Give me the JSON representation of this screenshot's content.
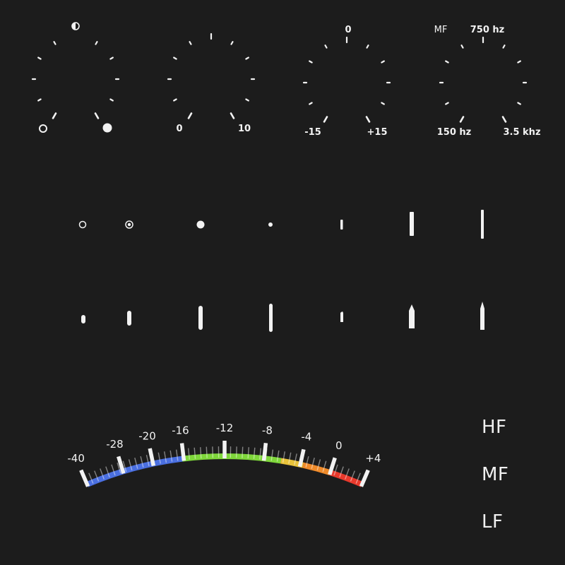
{
  "knobs": [
    {
      "id": "knob-pan",
      "top_label": "",
      "left_label": "",
      "right_label": "",
      "min_icon": "ring",
      "max_icon": "dot",
      "top_icon": "half-circle"
    },
    {
      "id": "knob-level",
      "top_label": "",
      "left_label": "0",
      "right_label": "10"
    },
    {
      "id": "knob-gain",
      "top_label": "0",
      "left_label": "-15",
      "right_label": "+15"
    },
    {
      "id": "knob-mf-freq",
      "corner_label": "MF",
      "top_label": "750 hz",
      "left_label": "150 hz",
      "right_label": "3.5 khz"
    }
  ],
  "vu_meter": {
    "labels": [
      "-40",
      "-28",
      "-20",
      "-16",
      "-12",
      "-8",
      "-4",
      "0",
      "+4"
    ],
    "colors": {
      "blue": "#4a6fe0",
      "green": "#7ed63a",
      "yellow": "#e8c23a",
      "orange": "#ee8a2a",
      "red": "#e8392c"
    }
  },
  "bands": [
    "HF",
    "MF",
    "LF"
  ],
  "colors": {
    "background": "#1c1c1c",
    "foreground": "#f2f2f2"
  }
}
